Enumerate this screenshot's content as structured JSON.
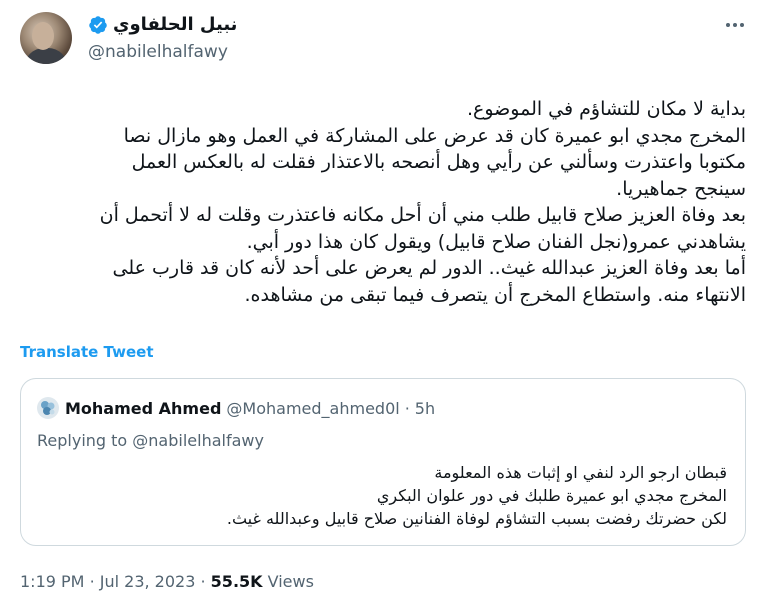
{
  "author": {
    "name": "نبيل الحلفاوي",
    "handle": "@nabilelhalfawy",
    "verified_color": "#1d9bf0"
  },
  "tweet": {
    "lines": [
      "بداية لا مكان للتشاؤم في الموضوع.",
      "المخرج مجدي ابو عميرة كان قد عرض على المشاركة في العمل وهو مازال نصا",
      "مكتوبا واعتذرت وسألني عن رأيي وهل أنصحه بالاعتذار فقلت له بالعكس العمل",
      "سينجح جماهيريا.",
      "بعد وفاة العزيز صلاح قابيل طلب مني أن أحل مكانه فاعتذرت وقلت له لا أتحمل أن",
      "يشاهدني عمرو(نجل الفنان صلاح قابيل) ويقول كان هذا دور أبي.",
      "أما بعد وفاة العزيز عبدالله غيث.. الدور لم يعرض على أحد لأنه كان قد قارب على",
      "الانتهاء منه. واستطاع المخرج أن يتصرف فيما تبقى من مشاهده."
    ],
    "translate_label": "Translate Tweet"
  },
  "quote": {
    "name": "Mohamed Ahmed",
    "handle": "@Mohamed_ahmed0l",
    "separator": "·",
    "time": "5h",
    "replying_to": "Replying to @nabilelhalfawy",
    "lines": [
      "قبطان ارجو الرد لنفي او إثبات هذه المعلومة",
      "المخرج مجدي ابو عميرة طلبك في دور علوان البكري",
      "لكن حضرتك رفضت بسبب التشاؤم  لوفاة الفنانين صلاح قابيل وعبدالله غيث."
    ]
  },
  "meta": {
    "time": "1:19 PM",
    "sep": "·",
    "date": "Jul 23, 2023",
    "views_count": "55.5K",
    "views_label": "Views"
  },
  "icons": {
    "verified": "verified-badge-icon",
    "more": "more-options-icon"
  }
}
